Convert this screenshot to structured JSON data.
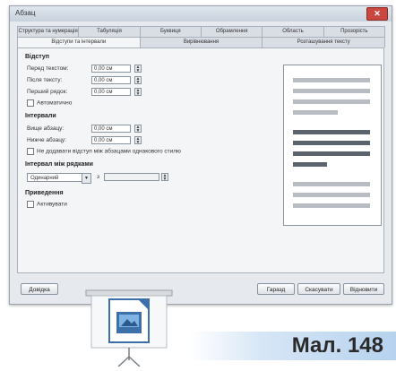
{
  "window": {
    "title": "Абзац",
    "close_label": "✕"
  },
  "tabs_row1": [
    "Структура та нумерація",
    "Табуляція",
    "Буквиця",
    "Обрамлення",
    "Область",
    "Прозорість"
  ],
  "tabs_row2": [
    "Відступи та інтервали",
    "Вирівнювання",
    "Розташування тексту"
  ],
  "indent": {
    "heading": "Відступ",
    "rows": [
      {
        "label": "Перед текстом:",
        "value": "0,00 см"
      },
      {
        "label": "Після тексту:",
        "value": "0,00 см"
      },
      {
        "label": "Перший рядок:",
        "value": "0,00 см"
      }
    ],
    "auto_label": "Автоматично"
  },
  "spacing": {
    "heading": "Інтервали",
    "rows": [
      {
        "label": "Вище абзацу:",
        "value": "0,00 см"
      },
      {
        "label": "Нижче абзацу:",
        "value": "0,00 см"
      }
    ],
    "no_space_label": "Не додавати відступ між абзацами однакового стилю"
  },
  "line_spacing": {
    "heading": "Інтервал між рядками",
    "select_value": "Одинарний",
    "of_label": "з"
  },
  "register": {
    "heading": "Приведення",
    "activate_label": "Активувати"
  },
  "buttons": {
    "help": "Довідка",
    "ok": "Гаразд",
    "cancel": "Скасувати",
    "reset": "Відновити"
  },
  "caption": "Мал. 148"
}
